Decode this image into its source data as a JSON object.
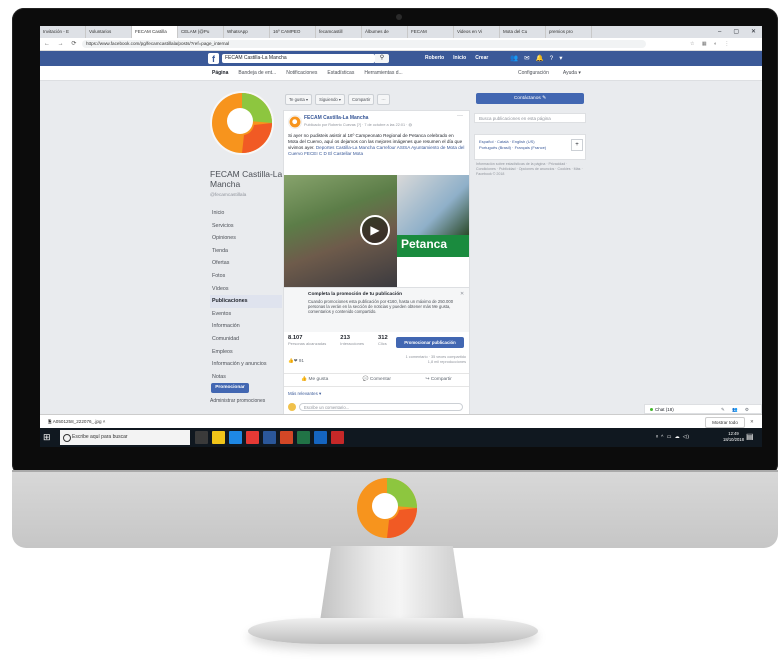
{
  "browser": {
    "tabs": [
      "Invitación - E",
      "Voluntarios",
      "FECAM Castilla",
      "CELAM (@Pu",
      "WhatsApp",
      "16º CAMPEO",
      "fecamcastill",
      "Álbumes de",
      "FECAM",
      "Videos en Vi",
      "Mota del Cu",
      "premios pro"
    ],
    "active_tab_index": 2,
    "url": "https://www.facebook.com/pg/fecamcastillala/posts/?ref=page_internal",
    "window_controls": [
      "–",
      "▢",
      "✕"
    ]
  },
  "facebook": {
    "logo": "f",
    "search_value": "FECAM Castilla-La Mancha",
    "nav": [
      "Roberto",
      "Inicio",
      "Crear"
    ],
    "subnav_left": [
      "Página",
      "Bandeja de ent...",
      "Notificaciones",
      "Estadísticas",
      "Herramientas d..."
    ],
    "subnav_right": [
      "Configuración",
      "Ayuda ▾"
    ]
  },
  "page": {
    "name": "FECAM Castilla-La Mancha",
    "handle": "@fecamcastillala",
    "menu": [
      "Inicio",
      "Servicios",
      "Opiniones",
      "Tienda",
      "Ofertas",
      "Fotos",
      "Vídeos",
      "Publicaciones",
      "Eventos",
      "Información",
      "Comunidad",
      "Empleos",
      "Información y anuncios",
      "Notas"
    ],
    "selected_menu_index": 7,
    "promote_label": "Promocionar",
    "admin_promos_label": "Administrar promociones"
  },
  "actions": [
    "Te gusta ▾",
    "Siguiendo ▾",
    "Compartir",
    "···"
  ],
  "post": {
    "author": "FECAM Castilla-La Mancha",
    "meta": "Publicado por Roberto Cuevas [?] · 7 de octubre a las 22:01 · ",
    "text": "Si ayer no pudisteis asistir al 16º Campeonato Regional de Petanca celebrado en Mota del Cuervo, aquí os dejamos con las mejores imágenes que resumen el día que vivimos ayer. ",
    "tags": "Deportes Castilla-La Mancha Carrefour ASISA Ayuntamiento de Mota del Cuervo FECEI C D El Castellar Mota",
    "image_word": "Petanca",
    "promo_title": "Completa la promoción de tu publicación",
    "promo_text": "Cuando promociones esta publicación por €160, hasta un máximo de 250.000 personas la verán en la sección de noticias y pueden obtener más Me gusta, comentarios y contenido compartido.",
    "reach": "8.107",
    "reach_label": "Personas alcanzadas",
    "interactions": "213",
    "interactions_label": "Interacciones",
    "clicks": "312",
    "clicks_label": "Clics",
    "boost_label": "Promocionar publicación",
    "reactions_count": "91",
    "share_info": "1 comentario · 35 veces compartido",
    "views": "1,8 mil reproducciones",
    "like_label": "Me gusta",
    "comment_label": "Comentar",
    "share_label": "Compartir",
    "relevance_label": "Más relevantes ▾",
    "comment_placeholder": "Escribe un comentario..."
  },
  "right": {
    "contact_label": "Contáctanos ✎",
    "search_placeholder": "Busca publicaciones en esta página",
    "langs_line1": "Español · Català · English (US)",
    "langs_line2": "Português (Brasil) · Français (France)",
    "footer": "Información sobre estadísticas de la página · Privacidad · Condiciones · Publicidad · Opciones de anuncios · Cookies · Más · Facebook © 2018"
  },
  "chat": {
    "label": "Chat (18)"
  },
  "download": {
    "file": "A0501258_222076_.jpg",
    "show_all": "Mostrar todo"
  },
  "taskbar": {
    "search_placeholder": "Escribe aquí para buscar",
    "time": "12:49",
    "date": "18/10/2018"
  },
  "colors": {
    "fb_blue": "#3b5998",
    "button_blue": "#4267b2",
    "logo_orange": "#f39c12",
    "logo_green": "#8dc63f"
  }
}
